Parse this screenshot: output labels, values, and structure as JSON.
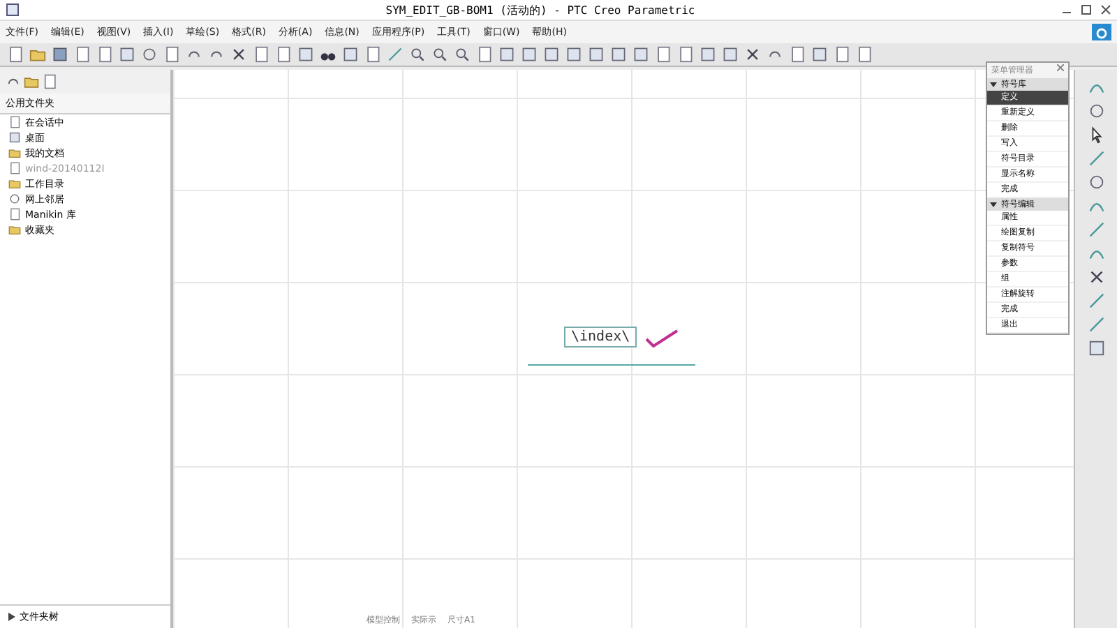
{
  "window": {
    "title": "SYM_EDIT_GB-BOM1 (活动的) - PTC Creo Parametric"
  },
  "menu_bar": [
    "文件(F)",
    "编辑(E)",
    "视图(V)",
    "插入(I)",
    "草绘(S)",
    "格式(R)",
    "分析(A)",
    "信息(N)",
    "应用程序(P)",
    "工具(T)",
    "窗口(W)",
    "帮助(H)"
  ],
  "folder_panel": {
    "title": "公用文件夹",
    "items": [
      {
        "label": "在会话中",
        "disabled": false
      },
      {
        "label": "桌面",
        "disabled": false
      },
      {
        "label": "我的文档",
        "disabled": false
      },
      {
        "label": "wind-20140112I",
        "disabled": true
      },
      {
        "label": "工作目录",
        "disabled": false
      },
      {
        "label": "网上邻居",
        "disabled": false
      },
      {
        "label": "Manikin 库",
        "disabled": false
      },
      {
        "label": "收藏夹",
        "disabled": false
      }
    ],
    "footer": "文件夹树"
  },
  "canvas": {
    "symbol_text": "\\index\\",
    "status": [
      "模型控制",
      "实际示",
      "尺寸A1"
    ]
  },
  "menu_manager": {
    "title": "菜单管理器",
    "sections": [
      {
        "title": "符号库",
        "expanded": true,
        "items": [
          {
            "label": "定义",
            "selected": true
          },
          {
            "label": "重新定义",
            "selected": false
          },
          {
            "label": "删除",
            "selected": false
          },
          {
            "label": "写入",
            "selected": false
          },
          {
            "label": "符号目录",
            "selected": false
          },
          {
            "label": "显示名称",
            "selected": false
          },
          {
            "label": "完成",
            "selected": false
          }
        ]
      },
      {
        "title": "符号编辑",
        "expanded": true,
        "items": [
          {
            "label": "属性",
            "selected": false
          },
          {
            "label": "绘图复制",
            "selected": false
          },
          {
            "label": "复制符号",
            "selected": false
          },
          {
            "label": "参数",
            "selected": false
          },
          {
            "label": "组",
            "selected": false
          },
          {
            "label": "注解旋转",
            "selected": false
          },
          {
            "label": "完成",
            "selected": false
          },
          {
            "label": "退出",
            "selected": false
          }
        ]
      }
    ]
  }
}
